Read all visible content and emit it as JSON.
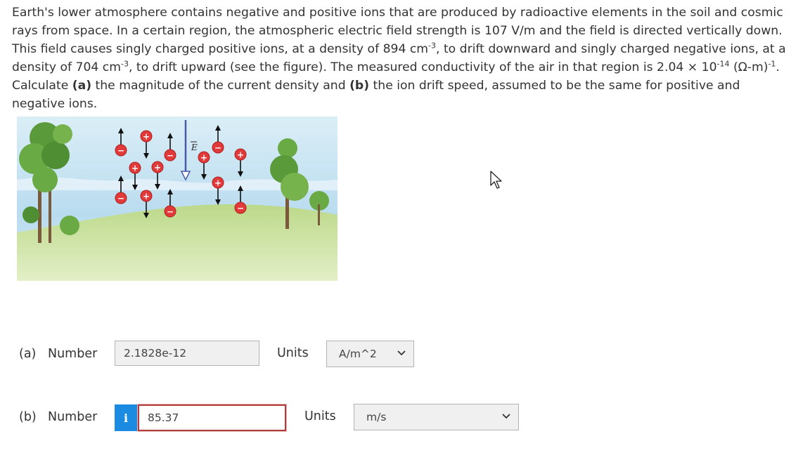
{
  "problem": {
    "t1": "Earth's lower atmosphere contains negative and positive ions that are produced by radioactive elements in the soil and cosmic rays from space. In a certain region, the atmospheric electric field strength is 107 V/m and the field is directed vertically down. This field causes singly charged positive ions, at a density of 894 cm",
    "sup1": "-3",
    "t2": ", to drift downward and singly charged negative ions, at a density of 704 cm",
    "sup2": "-3",
    "t3": ", to drift upward (see the figure). The measured conductivity of the air in that region is 2.04 × 10",
    "sup3": "-14",
    "t4": " (Ω-m)",
    "sup4": "-1",
    "t5": ". Calculate ",
    "a_bold": "(a)",
    "t6": " the magnitude of the current density and ",
    "b_bold": "(b)",
    "t7": " the ion drift speed, assumed to be the same for positive and negative ions."
  },
  "figure": {
    "field_label": "E",
    "plus_symbol": "+",
    "minus_symbol": "−"
  },
  "part_a": {
    "part_label": "(a)",
    "kind_label": "Number",
    "value": "2.1828e-12",
    "units_label": "Units",
    "unit_selected": "A/m^2"
  },
  "part_b": {
    "part_label": "(b)",
    "kind_label": "Number",
    "info_icon": "i",
    "value": "85.37",
    "units_label": "Units",
    "unit_selected": "m/s"
  },
  "icons": {
    "cursor": "mouse-pointer-icon",
    "dropdown": "chevron-down-icon",
    "info": "info-icon"
  },
  "colors": {
    "info_badge": "#1a8be0",
    "invalid_border": "#b23b3b",
    "ion": "#e03a3a",
    "field_arrow": "#4a5aa8"
  }
}
